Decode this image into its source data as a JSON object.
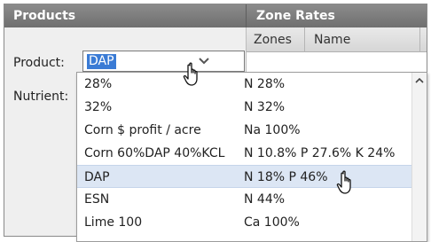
{
  "products_header": "Products",
  "zone_rates_header": "Zone Rates",
  "zone_grid": {
    "col_zones": "Zones",
    "col_name": "Name"
  },
  "product_label": "Product:",
  "nutrient_label": "Nutrient:",
  "product_combo_value": "DAP",
  "dropdown_items": [
    {
      "name": "28%",
      "nutrients": "N 28%"
    },
    {
      "name": "32%",
      "nutrients": "N 32%"
    },
    {
      "name": "Corn $ profit / acre",
      "nutrients": "Na 100%"
    },
    {
      "name": "Corn 60%DAP 40%KCL",
      "nutrients": "N 10.8% P 27.6% K 24%"
    },
    {
      "name": "DAP",
      "nutrients": "N 18% P 46%"
    },
    {
      "name": "ESN",
      "nutrients": "N 44%"
    },
    {
      "name": "Lime 100",
      "nutrients": "Ca 100%"
    }
  ],
  "selected_index": 4,
  "colors": {
    "header_bg": "#7a7a7a",
    "selection": "#3a7bd5",
    "row_highlight": "#dce6f4",
    "zone_swatch": "#1f3fd6"
  },
  "icons": [
    "chevron-down-icon",
    "hand-pointer-icon",
    "scroll-up-arrow-icon"
  ]
}
